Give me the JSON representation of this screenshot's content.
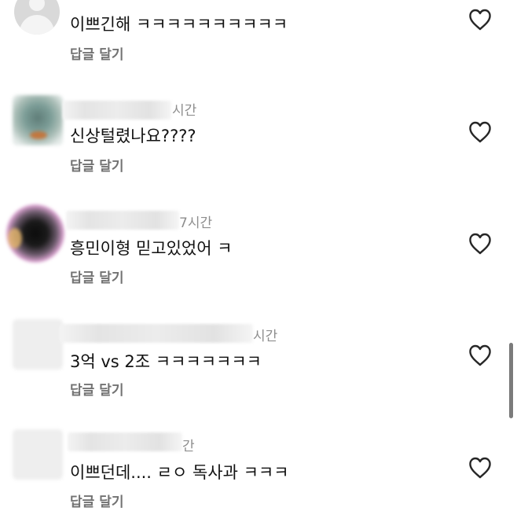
{
  "comments": [
    {
      "time": "",
      "text": "이쁘긴해 ㅋㅋㅋㅋㅋㅋㅋㅋㅋㅋ",
      "reply_label": "답글 달기",
      "avatar": "default-user-avatar"
    },
    {
      "time": "시간",
      "text": "신상털렸나요????",
      "reply_label": "답글 달기",
      "avatar": "blurred-avatar"
    },
    {
      "time": "7시간",
      "text": "흥민이형 믿고있었어 ㅋ",
      "reply_label": "답글 달기",
      "avatar": "blurred-avatar"
    },
    {
      "time": "시간",
      "text": "3억 vs 2조 ㅋㅋㅋㅋㅋㅋㅋ",
      "reply_label": "답글 달기",
      "avatar": "blurred-avatar"
    },
    {
      "time": "간",
      "text": "이쁘던데.... ㄹㅇ 독사과 ㅋㅋㅋ",
      "reply_label": "답글 달기",
      "avatar": "blurred-avatar"
    }
  ],
  "icons": {
    "like": "heart-outline-icon"
  },
  "colors": {
    "text": "#111111",
    "secondary_text": "#737373",
    "timestamp": "#8e8e8e",
    "heart_stroke": "#262626",
    "scrollbar": "#7b7b7b"
  }
}
